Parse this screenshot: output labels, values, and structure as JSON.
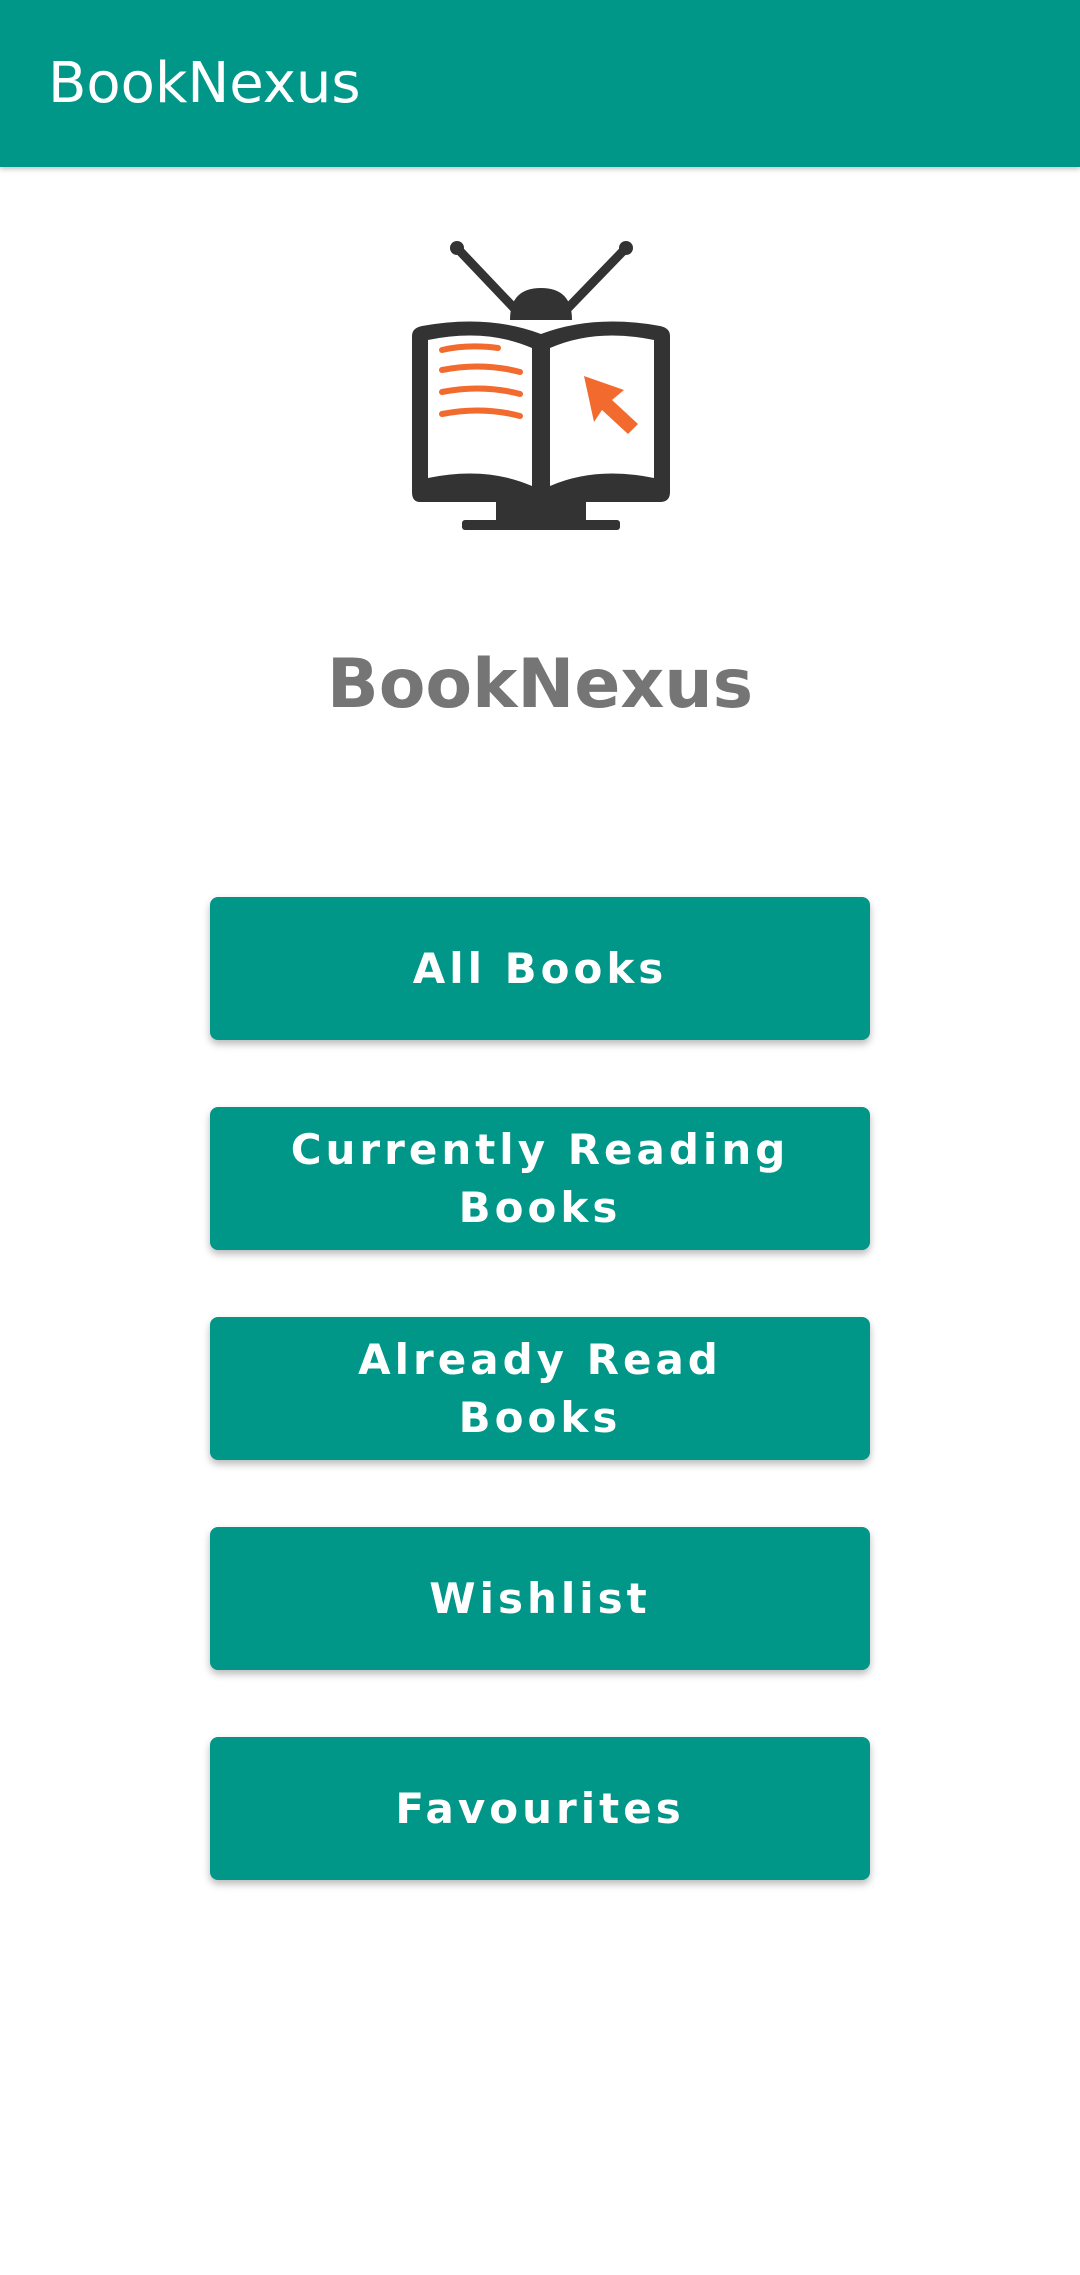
{
  "app_bar": {
    "title": "BookNexus"
  },
  "logo": {
    "icon": "book-monitor-icon",
    "colors": {
      "body": "#333333",
      "accent": "#F26A2E"
    }
  },
  "brand": {
    "name": "BookNexus"
  },
  "menu": {
    "buttons": [
      {
        "label": "All Books"
      },
      {
        "label": "Currently Reading Books"
      },
      {
        "label": "Already Read Books"
      },
      {
        "label": "Wishlist"
      },
      {
        "label": "Favourites"
      }
    ]
  },
  "theme": {
    "primary": "#009688",
    "brand_text": "#757575",
    "background": "#FFFFFF"
  }
}
